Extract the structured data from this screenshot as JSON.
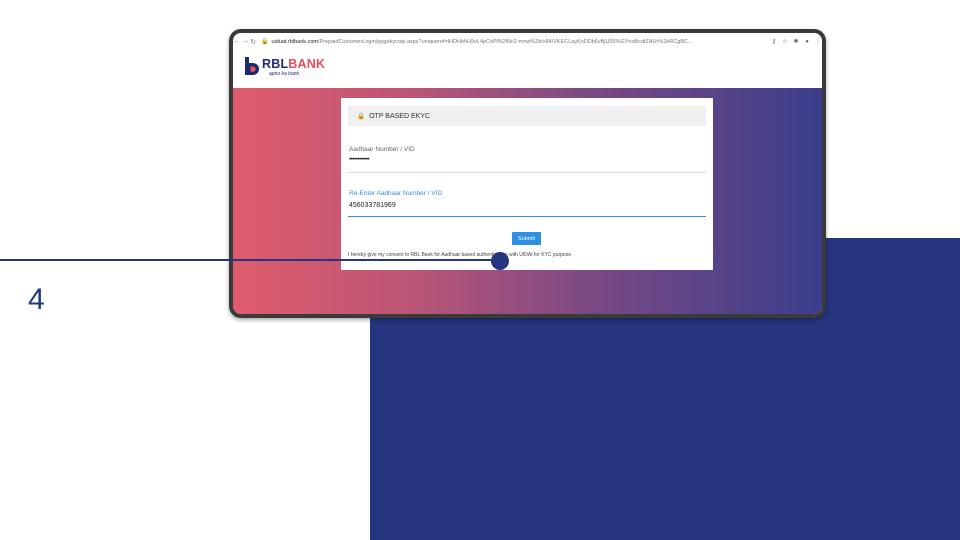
{
  "browser": {
    "url_host": "uiduat.rblbank.com",
    "url_path": "/PrepaidCustomerLogin/ppgekycotp.aspx?uniqueref=lHDHbhH9vL4pCsPl%2fNc2-mnw%2bIx84/VKECLayKnDDb6vBjU55%GYnoBcdtZAUr%2bRCgBC..."
  },
  "site": {
    "logo_rbl": "RBL",
    "logo_bank": "BANK",
    "tagline": "apno ka bank"
  },
  "form": {
    "header_title": "OTP BASED EKYC",
    "aadhaar_label": "Aadhaar Number / VID",
    "aadhaar_value": "••••••••••••",
    "reenter_label": "Re-Enter Aadhaar Number / VID",
    "reenter_value": "456033781969",
    "submit_label": "Submit",
    "consent_text": "I hereby give my consent to RBL Bank for Aadhaar based authentication with UIDAI for KYC purpose."
  },
  "annotation": {
    "step_number": "4"
  },
  "colors": {
    "navy": "#263580",
    "gradient_start": "#e05c6c",
    "gradient_end": "#3a3e8c",
    "submit_blue": "#2f8fe0",
    "active_field_blue": "#3a8ed8"
  },
  "icons": [
    "back-arrow-icon",
    "forward-arrow-icon",
    "reload-icon",
    "lock-icon",
    "key-icon",
    "star-icon",
    "extensions-icon",
    "profile-icon",
    "menu-icon"
  ]
}
